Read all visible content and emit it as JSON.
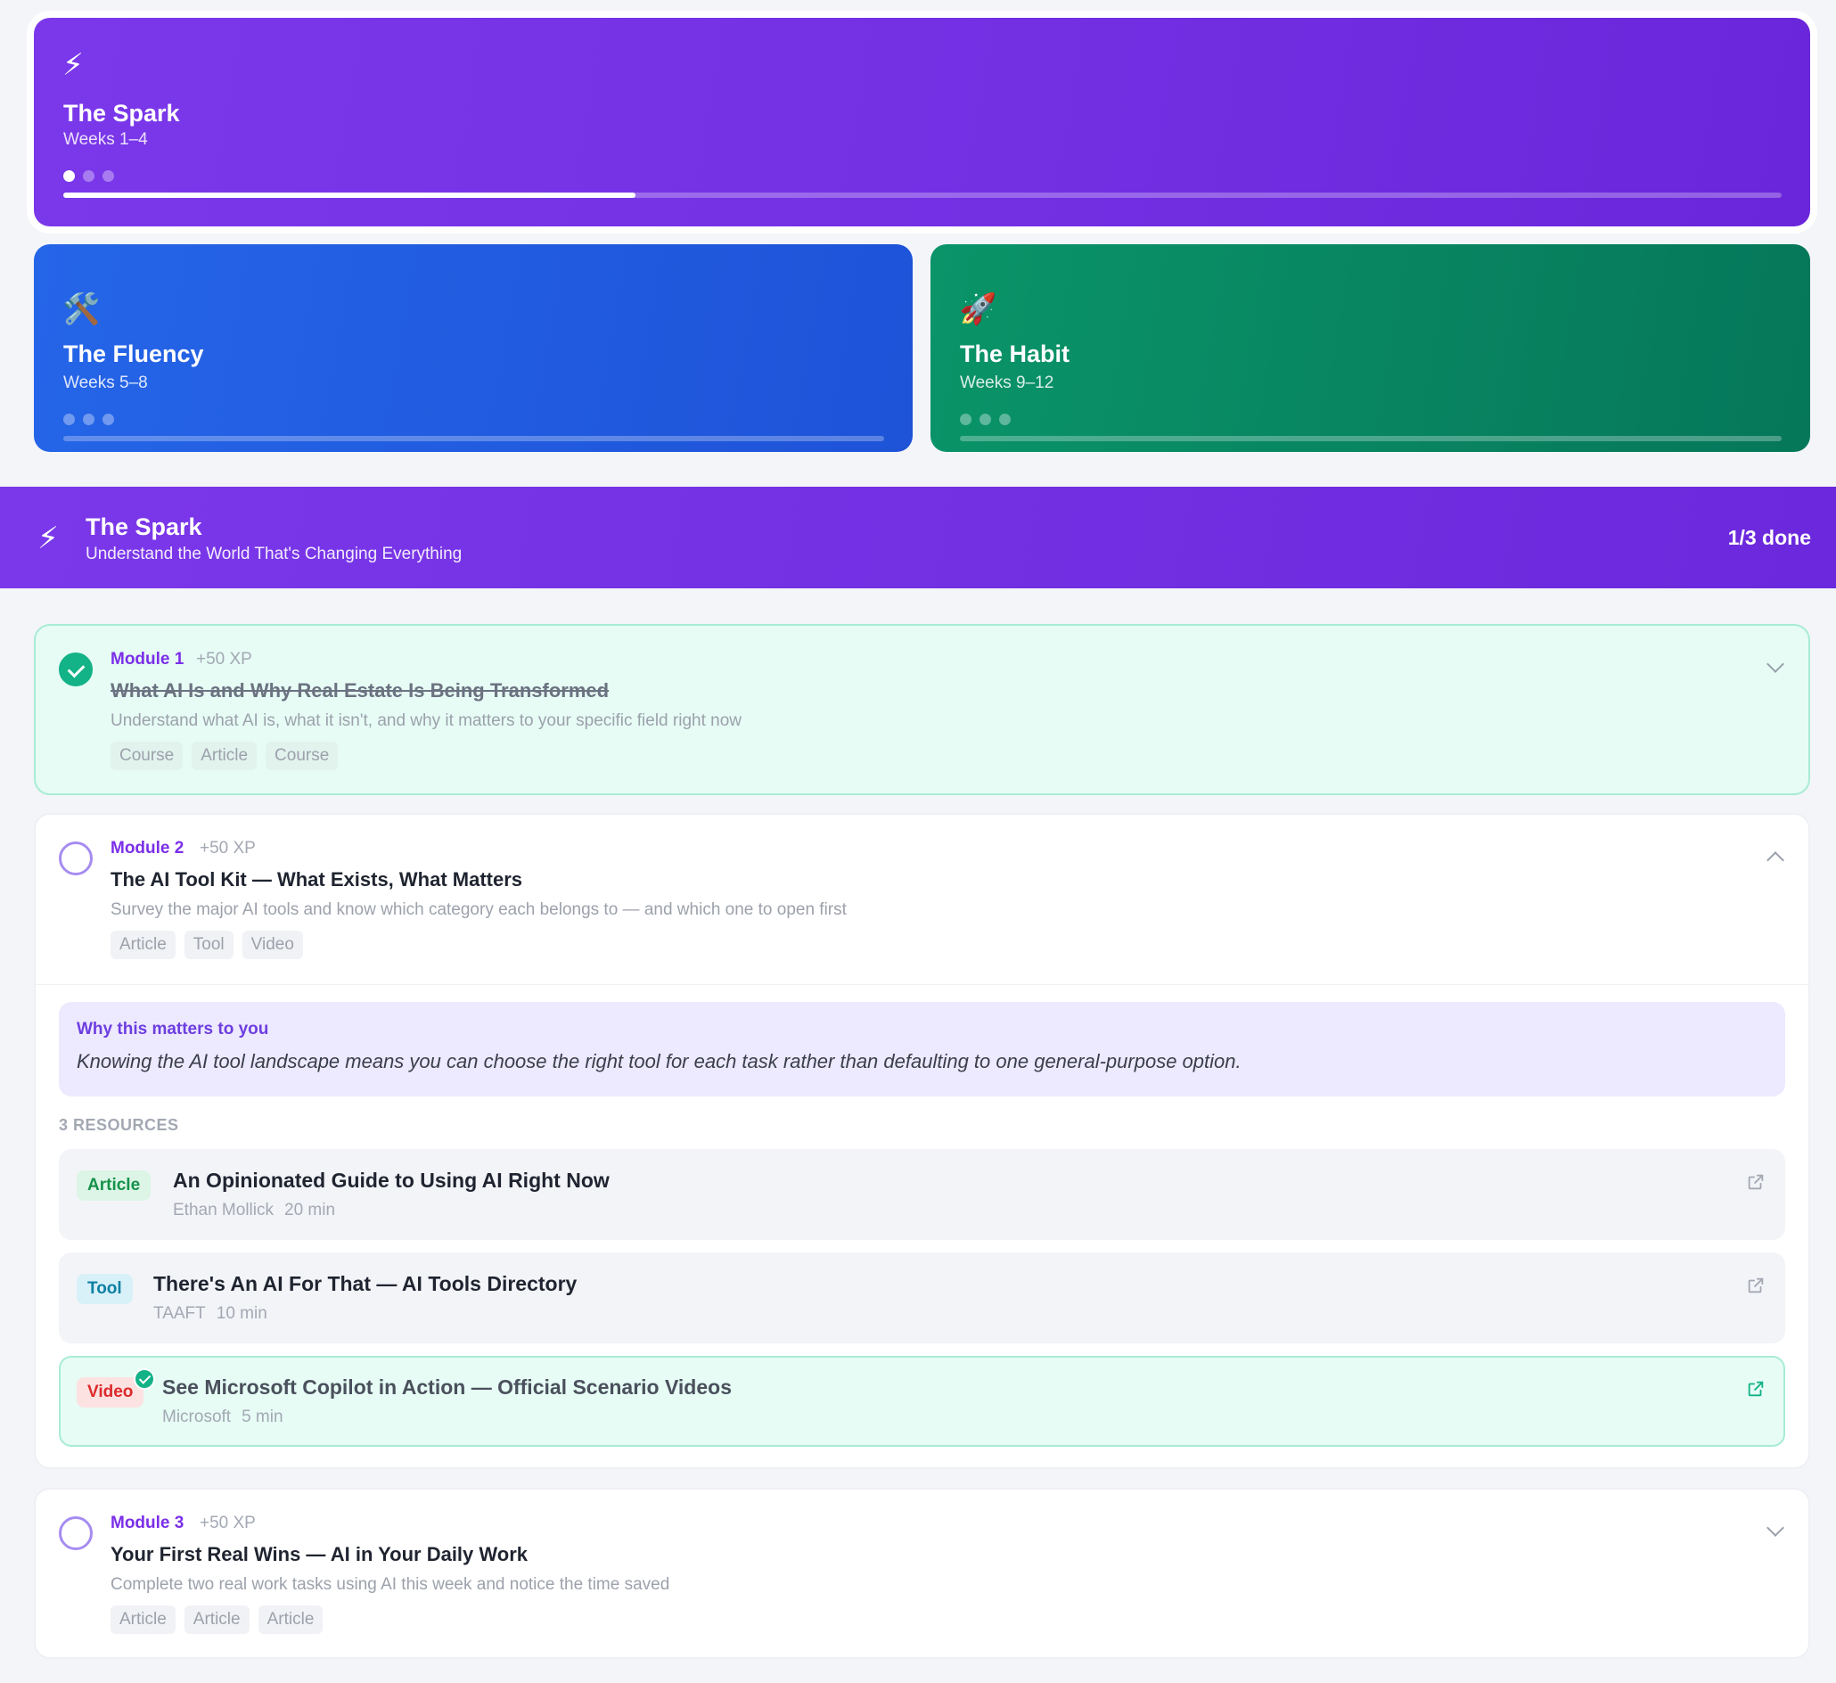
{
  "phases": [
    {
      "icon": "⚡",
      "title": "The Spark",
      "weeks": "Weeks 1–4",
      "progress": 0.333,
      "dots_on": 1
    },
    {
      "icon": "🛠️",
      "title": "The Fluency",
      "weeks": "Weeks 5–8",
      "progress": 0,
      "dots_on": 0
    },
    {
      "icon": "🚀",
      "title": "The Habit",
      "weeks": "Weeks 9–12",
      "progress": 0,
      "dots_on": 0
    }
  ],
  "section": {
    "icon": "⚡",
    "title": "The Spark",
    "subtitle": "Understand the World That's Changing Everything",
    "count": "1/3 done"
  },
  "modules": [
    {
      "label": "Module 1",
      "xp": "+50 XP",
      "title": "What AI Is and Why Real Estate Is Being Transformed",
      "description": "Understand what AI is, what it isn't, and why it matters to your specific field right now",
      "tags": [
        "Course",
        "Article",
        "Course"
      ],
      "done": true
    },
    {
      "label": "Module 2",
      "xp": "+50 XP",
      "title": "The AI Tool Kit — What Exists, What Matters",
      "description": "Survey the major AI tools and know which category each belongs to — and which one to open first",
      "tags": [
        "Article",
        "Tool",
        "Video"
      ],
      "done": false,
      "why_title": "Why this matters to you",
      "why_text": "Knowing the AI tool landscape means you can choose the right tool for each task rather than defaulting to one general-purpose option.",
      "resources_count": "3 RESOURCES",
      "resources": [
        {
          "type": "Article",
          "title": "An Opinionated Guide to Using AI Right Now",
          "source": "Ethan Mollick",
          "duration": "20 min",
          "done": false
        },
        {
          "type": "Tool",
          "title": "There's An AI For That — AI Tools Directory",
          "source": "TAAFT",
          "duration": "10 min",
          "done": false
        },
        {
          "type": "Video",
          "title": "See Microsoft Copilot in Action — Official Scenario Videos",
          "source": "Microsoft",
          "duration": "5 min",
          "done": true
        }
      ]
    },
    {
      "label": "Module 3",
      "xp": "+50 XP",
      "title": "Your First Real Wins — AI in Your Daily Work",
      "description": "Complete two real work tasks using AI this week and notice the time saved",
      "tags": [
        "Article",
        "Article",
        "Article"
      ],
      "done": false
    }
  ]
}
